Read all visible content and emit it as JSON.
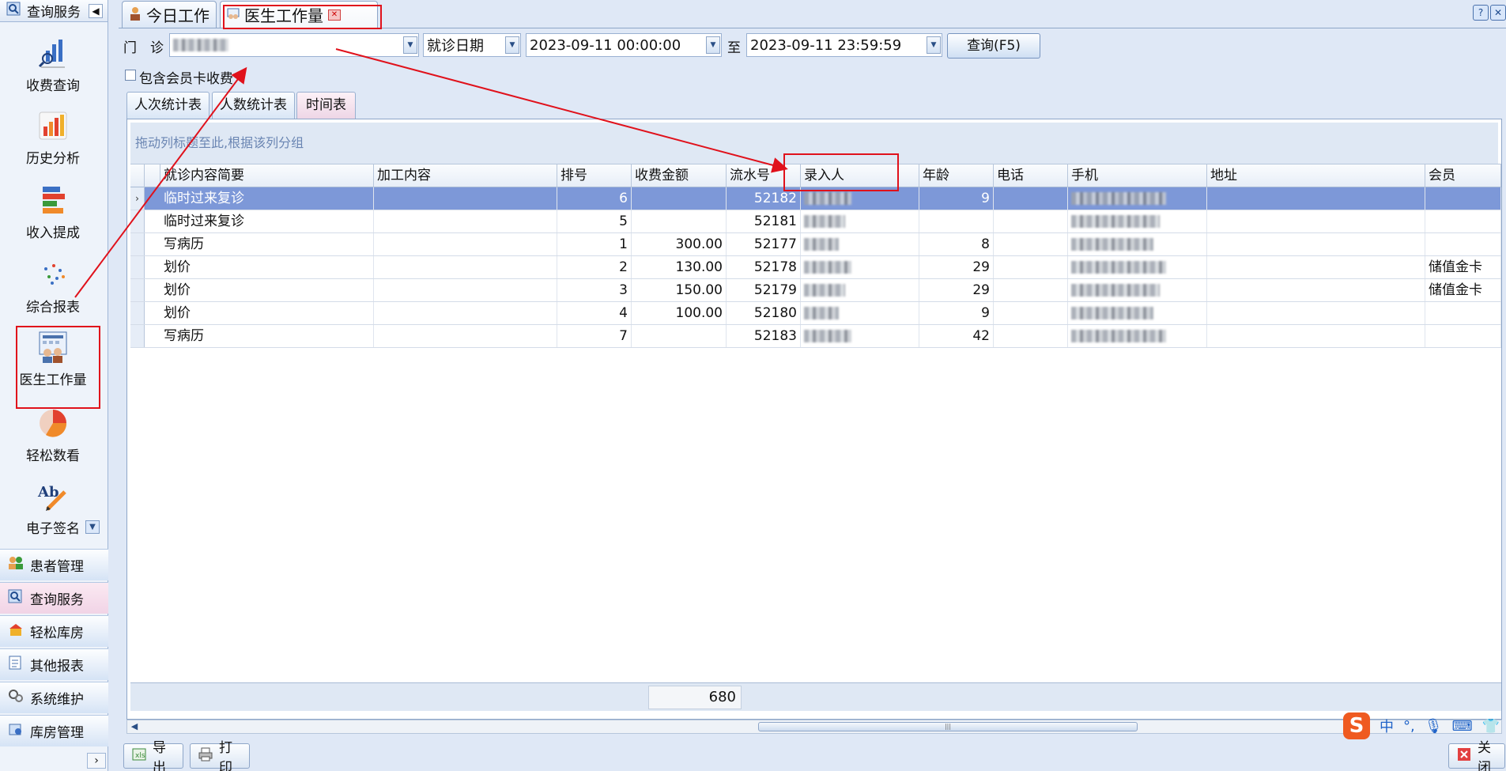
{
  "sidebar": {
    "header_label": "查询服务",
    "items": [
      {
        "label": "收费查询",
        "icon": "search-chart-icon"
      },
      {
        "label": "历史分析",
        "icon": "bar-chart-icon"
      },
      {
        "label": "收入提成",
        "icon": "stacked-bars-icon"
      },
      {
        "label": "综合报表",
        "icon": "scatter-dots-icon"
      },
      {
        "label": "医生工作量",
        "icon": "doctor-workload-icon"
      },
      {
        "label": "轻松数看",
        "icon": "pie-chart-icon"
      },
      {
        "label": "电子签名",
        "icon": "signature-icon"
      }
    ],
    "signature_letters": "Ab",
    "groups": [
      {
        "label": "患者管理",
        "icon": "patients-icon"
      },
      {
        "label": "查询服务",
        "icon": "query-icon",
        "active": true
      },
      {
        "label": "轻松库房",
        "icon": "warehouse-icon"
      },
      {
        "label": "其他报表",
        "icon": "reports-icon"
      },
      {
        "label": "系统维护",
        "icon": "settings-icon"
      },
      {
        "label": "库房管理",
        "icon": "store-icon"
      }
    ]
  },
  "tabs": [
    {
      "label": "今日工作",
      "icon": "user-icon"
    },
    {
      "label": "医生工作量",
      "icon": "doctor-workload-icon",
      "active": true
    }
  ],
  "filters": {
    "clinic_label": "门　诊",
    "date_type": "就诊日期",
    "start_time": "2023-09-11 00:00:00",
    "to_label": "至",
    "end_time": "2023-09-11 23:59:59",
    "query_button": "查询(F5)",
    "member_card_checkbox_label": "包含会员卡收费",
    "member_card_checked": false
  },
  "inner_tabs": [
    {
      "label": "人次统计表"
    },
    {
      "label": "人数统计表"
    },
    {
      "label": "时间表",
      "active": true
    }
  ],
  "grid": {
    "group_hint": "拖动列标题至此,根据该列分组",
    "columns": [
      "就诊内容简要",
      "加工内容",
      "排号",
      "收费金额",
      "流水号",
      "录入人",
      "年龄",
      "电话",
      "手机",
      "地址",
      "会员"
    ],
    "rows": [
      {
        "content": "临时过来复诊",
        "process": "",
        "queue": "6",
        "amount": "",
        "serial": "52182",
        "age": "9",
        "member": "",
        "selected": true
      },
      {
        "content": "临时过来复诊",
        "process": "",
        "queue": "5",
        "amount": "",
        "serial": "52181",
        "age": "",
        "member": ""
      },
      {
        "content": "写病历",
        "process": "",
        "queue": "1",
        "amount": "300.00",
        "serial": "52177",
        "age": "8",
        "member": ""
      },
      {
        "content": "划价",
        "process": "",
        "queue": "2",
        "amount": "130.00",
        "serial": "52178",
        "age": "29",
        "member": "储值金卡"
      },
      {
        "content": "划价",
        "process": "",
        "queue": "3",
        "amount": "150.00",
        "serial": "52179",
        "age": "29",
        "member": "储值金卡"
      },
      {
        "content": "划价",
        "process": "",
        "queue": "4",
        "amount": "100.00",
        "serial": "52180",
        "age": "9",
        "member": ""
      },
      {
        "content": "写病历",
        "process": "",
        "queue": "7",
        "amount": "",
        "serial": "52183",
        "age": "42",
        "member": ""
      }
    ],
    "footer_total": "680"
  },
  "bottom": {
    "export_label": "导出",
    "print_label": "打印",
    "close_label": "关闭"
  },
  "ime": {
    "logo": "S",
    "mode": "中",
    "punct": "°,"
  },
  "annotation_color": "#e0111b"
}
